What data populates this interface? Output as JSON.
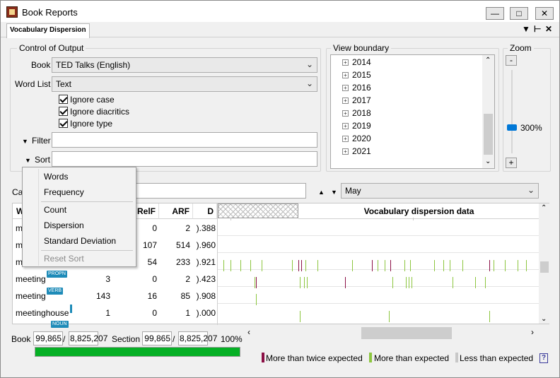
{
  "window": {
    "title": "Book Reports",
    "tab": "Vocabulary Dispersion"
  },
  "control": {
    "legend": "Control of Output",
    "book_label": "Book",
    "book_value": "TED Talks (English)",
    "wordlist_label": "Word List",
    "wordlist_value": "Text",
    "checks": [
      "Ignore case",
      "Ignore diacritics",
      "Ignore type"
    ],
    "filter_label": "Filter",
    "sort_label": "Sort"
  },
  "view": {
    "legend": "View boundary",
    "years": [
      "2014",
      "2015",
      "2016",
      "2017",
      "2018",
      "2019",
      "2020",
      "2021"
    ]
  },
  "zoom": {
    "legend": "Zoom",
    "minus": "-",
    "plus": "+",
    "value": "300%"
  },
  "middle": {
    "left_label_fragment": "Ca",
    "month_value": "May"
  },
  "sort_menu": {
    "items": [
      "Words",
      "Frequency",
      "Count",
      "Dispersion",
      "Standard Deviation"
    ],
    "reset": "Reset Sort"
  },
  "table": {
    "headers": {
      "word": "W",
      "relf": "RelF",
      "arf": "ARF",
      "d": "D",
      "dispersion": "Vocabulary dispersion data"
    },
    "rows": [
      {
        "word": "m",
        "count": "",
        "relf": "0",
        "arf": "2",
        "d": ").388",
        "badge": ""
      },
      {
        "word": "m",
        "count": "",
        "relf": "107",
        "arf": "514",
        "d": ").960",
        "badge": ""
      },
      {
        "word": "m",
        "count": "",
        "relf": "54",
        "arf": "233",
        "d": ").921",
        "badge": ""
      },
      {
        "word": "meeting",
        "count": "3",
        "relf": "0",
        "arf": "2",
        "d": ").423",
        "badge": "PROPN"
      },
      {
        "word": "meeting",
        "count": "143",
        "relf": "16",
        "arf": "85",
        "d": ").908",
        "badge": "VERB"
      },
      {
        "word": "meetinghouse",
        "count": "1",
        "relf": "0",
        "arf": "1",
        "d": ").000",
        "badge": ""
      }
    ],
    "partial_badge": "NOUN"
  },
  "status": {
    "book_label": "Book",
    "book_a": "99,865",
    "book_b": "8,825,207",
    "section_label": "Section",
    "section_a": "99,865",
    "section_b": "8,825,207",
    "percent": "100%",
    "progress": 1.0
  },
  "legend": {
    "items": [
      {
        "label": "More than twice expected",
        "color": "#8b1046"
      },
      {
        "label": "More than expected",
        "color": "#8cc63f"
      },
      {
        "label": "Less than expected",
        "color": "#c8c8c8"
      }
    ],
    "help": "?"
  },
  "colors": {
    "strong": "#8b1046",
    "above": "#8cc63f",
    "scroll_thumb": "#cdcdcd",
    "progress": "#06b025",
    "slider": "#0078d7"
  }
}
